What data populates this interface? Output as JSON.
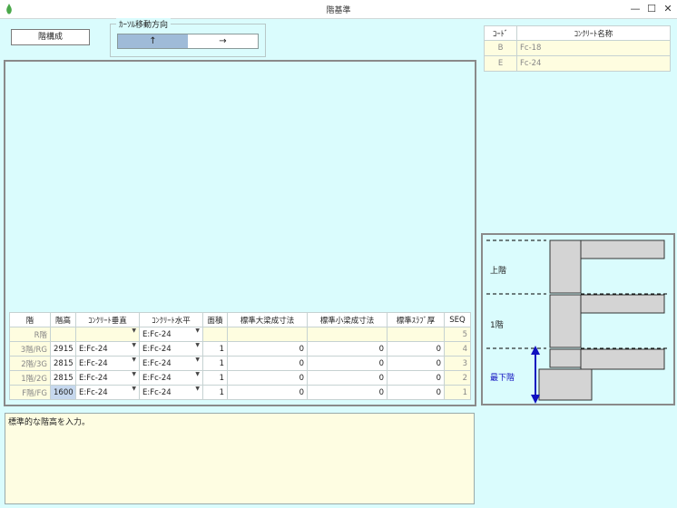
{
  "window": {
    "title": "階基準",
    "min": "—",
    "max": "☐",
    "close": "✕"
  },
  "toolbar": {
    "floor_config_label": "階構成"
  },
  "cursor_group": {
    "title": "ｶｰｿﾙ移動方向",
    "up": "↑",
    "right": "→"
  },
  "floor_grid": {
    "headers": [
      "階",
      "階高",
      "ｺﾝｸﾘｰﾄ垂直",
      "ｺﾝｸﾘｰﾄ水平",
      "面積",
      "標準大梁成寸法",
      "標準小梁成寸法",
      "標準ｽﾗﾌﾞ厚",
      "SEQ"
    ],
    "rows": [
      {
        "floor": "R階",
        "height": "",
        "conc_v": "",
        "conc_h": "E:Fc-24",
        "area": "",
        "beam_large": "",
        "beam_small": "",
        "slab": "",
        "seq": "5"
      },
      {
        "floor": "3階/RG",
        "height": "2915",
        "conc_v": "E:Fc-24",
        "conc_h": "E:Fc-24",
        "area": "1",
        "beam_large": "0",
        "beam_small": "0",
        "slab": "0",
        "seq": "4"
      },
      {
        "floor": "2階/3G",
        "height": "2815",
        "conc_v": "E:Fc-24",
        "conc_h": "E:Fc-24",
        "area": "1",
        "beam_large": "0",
        "beam_small": "0",
        "slab": "0",
        "seq": "3"
      },
      {
        "floor": "1階/2G",
        "height": "2815",
        "conc_v": "E:Fc-24",
        "conc_h": "E:Fc-24",
        "area": "1",
        "beam_large": "0",
        "beam_small": "0",
        "slab": "0",
        "seq": "2"
      },
      {
        "floor": "F階/FG",
        "height": "1600",
        "conc_v": "E:Fc-24",
        "conc_h": "E:Fc-24",
        "area": "1",
        "beam_large": "0",
        "beam_small": "0",
        "slab": "0",
        "seq": "1"
      }
    ]
  },
  "code_table": {
    "headers": [
      "ｺｰﾄﾞ",
      "ｺﾝｸﾘｰﾄ名称"
    ],
    "rows": [
      {
        "code": "B",
        "name": "Fc-18"
      },
      {
        "code": "E",
        "name": "Fc-24"
      }
    ]
  },
  "diagram": {
    "upper": "上階",
    "one": "1階",
    "lowest": "最下階"
  },
  "message": "標準的な階高を入力。",
  "colors": {
    "background": "#dafcfd",
    "yellow_row": "#fefde0",
    "selected": "#c6d8ee",
    "arrow": "#1010c0",
    "block": "#d4d4d4"
  }
}
